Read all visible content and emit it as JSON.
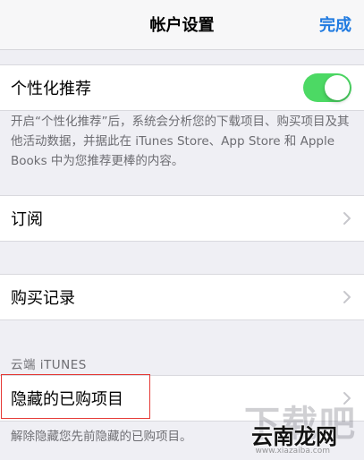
{
  "nav": {
    "title": "帐户设置",
    "done_label": "完成"
  },
  "personalized": {
    "label": "个性化推荐",
    "toggle_on": true,
    "toggle_color": "#4cd964",
    "description": "开启“个性化推荐”后，系统会分析您的下载项目、购买项目及其他活动数据，并据此在 iTunes Store、App Store 和 Apple Books 中为您推荐更棒的内容。"
  },
  "subscriptions": {
    "label": "订阅"
  },
  "purchase_history": {
    "label": "购买记录"
  },
  "cloud_section": {
    "header": "云端 iTUNES",
    "hidden_purchases_label": "隐藏的已购项目",
    "hidden_purchases_footnote": "解除隐藏您先前隐藏的已购项目。"
  },
  "watermark": {
    "big": "下载吧",
    "small": "云南龙网",
    "url": "www.xiazaiba.com"
  },
  "colors": {
    "accent": "#1f7ae0",
    "highlight": "#e53935",
    "background": "#efeff4"
  }
}
